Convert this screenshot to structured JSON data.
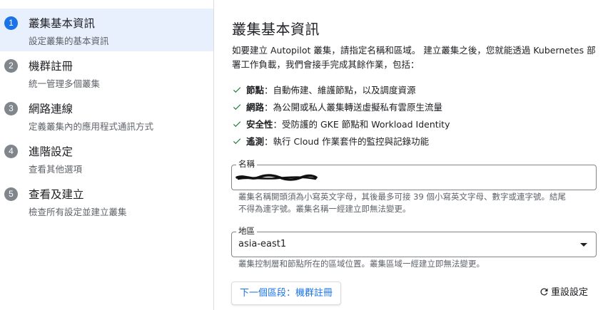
{
  "steps": [
    {
      "num": "1",
      "title": "叢集基本資訊",
      "subtitle": "設定叢集的基本資訊",
      "active": true
    },
    {
      "num": "2",
      "title": "機群註冊",
      "subtitle": "統一管理多個叢集"
    },
    {
      "num": "3",
      "title": "網路連線",
      "subtitle": "定義叢集內的應用程式通訊方式"
    },
    {
      "num": "4",
      "title": "進階設定",
      "subtitle": "查看其他選項"
    },
    {
      "num": "5",
      "title": "查看及建立",
      "subtitle": "檢查所有設定並建立叢集"
    }
  ],
  "main": {
    "title": "叢集基本資訊",
    "intro": "如要建立 Autopilot 叢集，請指定名稱和區域。 建立叢集之後，您就能透過 Kubernetes 部署工作負載，我們會接手完成其餘作業，包括：",
    "features": [
      {
        "label": "節點",
        "text": "：自動佈建、維護節點，以及調度資源"
      },
      {
        "label": "網路",
        "text": "：為公開或私人叢集轉送虛擬私有雲原生流量"
      },
      {
        "label": "安全性",
        "text": "：受防護的 GKE 節點和 Workload Identity"
      },
      {
        "label": "遙測",
        "text": "：執行 Cloud 作業套件的監控與記錄功能"
      }
    ],
    "name_field": {
      "label": "名稱",
      "hint": "叢集名稱開頭須為小寫英文字母，其後最多可接 39 個小寫英文字母、數字或連字號。結尾不得為連字號。叢集名稱一經建立即無法變更。"
    },
    "region_field": {
      "label": "地區",
      "value": "asia-east1",
      "hint": "叢集控制層和節點所在的區域位置。叢集區域一經建立即無法變更。"
    },
    "next_button": "下一個區段：機群註冊",
    "reset_button": "重設設定"
  },
  "colors": {
    "accent": "#1a73e8",
    "check": "#188038",
    "active_bg": "#e8f0fe"
  }
}
